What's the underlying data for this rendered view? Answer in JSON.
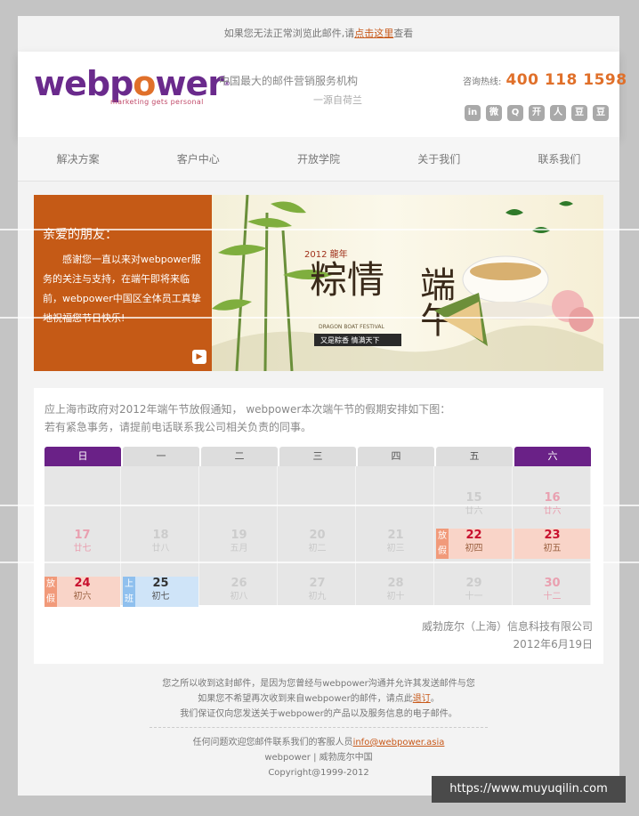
{
  "top_note": {
    "prefix": "如果您无法正常浏览此邮件,请",
    "link": "点击这里",
    "suffix": "查看"
  },
  "header": {
    "brand_prefix": "webp",
    "brand_o": "o",
    "brand_suffix": "wer",
    "brand_reg": "®",
    "brand_tagline": "marketing gets personal",
    "slogan": "中国最大的邮件营销服务机构",
    "slogan_sub": "一源自荷兰",
    "hotline_label": "咨询热线:",
    "hotline_number": "400 118 1598",
    "social": [
      "in",
      "微",
      "Q",
      "开",
      "人",
      "豆",
      "豆"
    ]
  },
  "nav": [
    "解决方案",
    "客户中心",
    "开放学院",
    "关于我们",
    "联系我们"
  ],
  "banner": {
    "greeting": "亲爱的朋友：",
    "message": "感谢您一直以来对webpower服务的关注与支持，在端午即将来临前，webpower中国区全体员工真挚地祝福您节日快乐!",
    "art_title": "端午",
    "art_sub": "粽情",
    "art_year": "2012 龍年",
    "art_en": "DRAGON BOAT FESTIVAL",
    "art_caption": "又是粽香 情满天下"
  },
  "notice": {
    "line1": "应上海市政府对2012年端午节放假通知， webpower本次端午节的假期安排如下图：",
    "line2": "若有紧急事务，请提前电话联系我公司相关负责的同事。"
  },
  "calendar": {
    "weekdays": [
      "日",
      "一",
      "二",
      "三",
      "四",
      "五",
      "六"
    ],
    "rows": [
      [
        null,
        null,
        null,
        null,
        null,
        {
          "d": "15",
          "l": "廿六"
        },
        {
          "d": "16",
          "l": "廿六",
          "red": true
        }
      ],
      [
        {
          "d": "17",
          "l": "廿七",
          "red": true
        },
        {
          "d": "18",
          "l": "廿八"
        },
        {
          "d": "19",
          "l": "五月"
        },
        {
          "d": "20",
          "l": "初二"
        },
        {
          "d": "21",
          "l": "初三"
        },
        {
          "d": "22",
          "l": "初四",
          "tag": "放假",
          "hi": true
        },
        {
          "d": "23",
          "l": "初五",
          "hi": true
        }
      ],
      [
        {
          "d": "24",
          "l": "初六",
          "tag": "放假",
          "hi": true
        },
        {
          "d": "25",
          "l": "初七",
          "tag": "上班",
          "blue": true
        },
        {
          "d": "26",
          "l": "初八"
        },
        {
          "d": "27",
          "l": "初九"
        },
        {
          "d": "28",
          "l": "初十"
        },
        {
          "d": "29",
          "l": "十一"
        },
        {
          "d": "30",
          "l": "十二",
          "red": true
        }
      ]
    ]
  },
  "sign": {
    "company": "威勃庞尔（上海）信息科技有限公司",
    "date": "2012年6月19日"
  },
  "footer": {
    "line1": "您之所以收到这封邮件，是因为您曾经与webpower沟通并允许其发送邮件与您",
    "line2_prefix": "如果您不希望再次收到来自webpower的邮件，请点此",
    "line2_link": "退订",
    "line2_suffix": "。",
    "line3": "我们保证仅向您发送关于webpower的产品以及服务信息的电子邮件。",
    "contact_prefix": "任何问题欢迎您邮件联系我们的客服人员",
    "contact_email": "info@webpower.asia",
    "company": "webpower | 威勃庞尔中国",
    "copyright": "Copyright@1999-2012"
  },
  "watermark": "https://www.muyuqilin.com",
  "colors": {
    "orange": "#c55a16",
    "purple": "#6a2187",
    "accent": "#e0702a"
  }
}
